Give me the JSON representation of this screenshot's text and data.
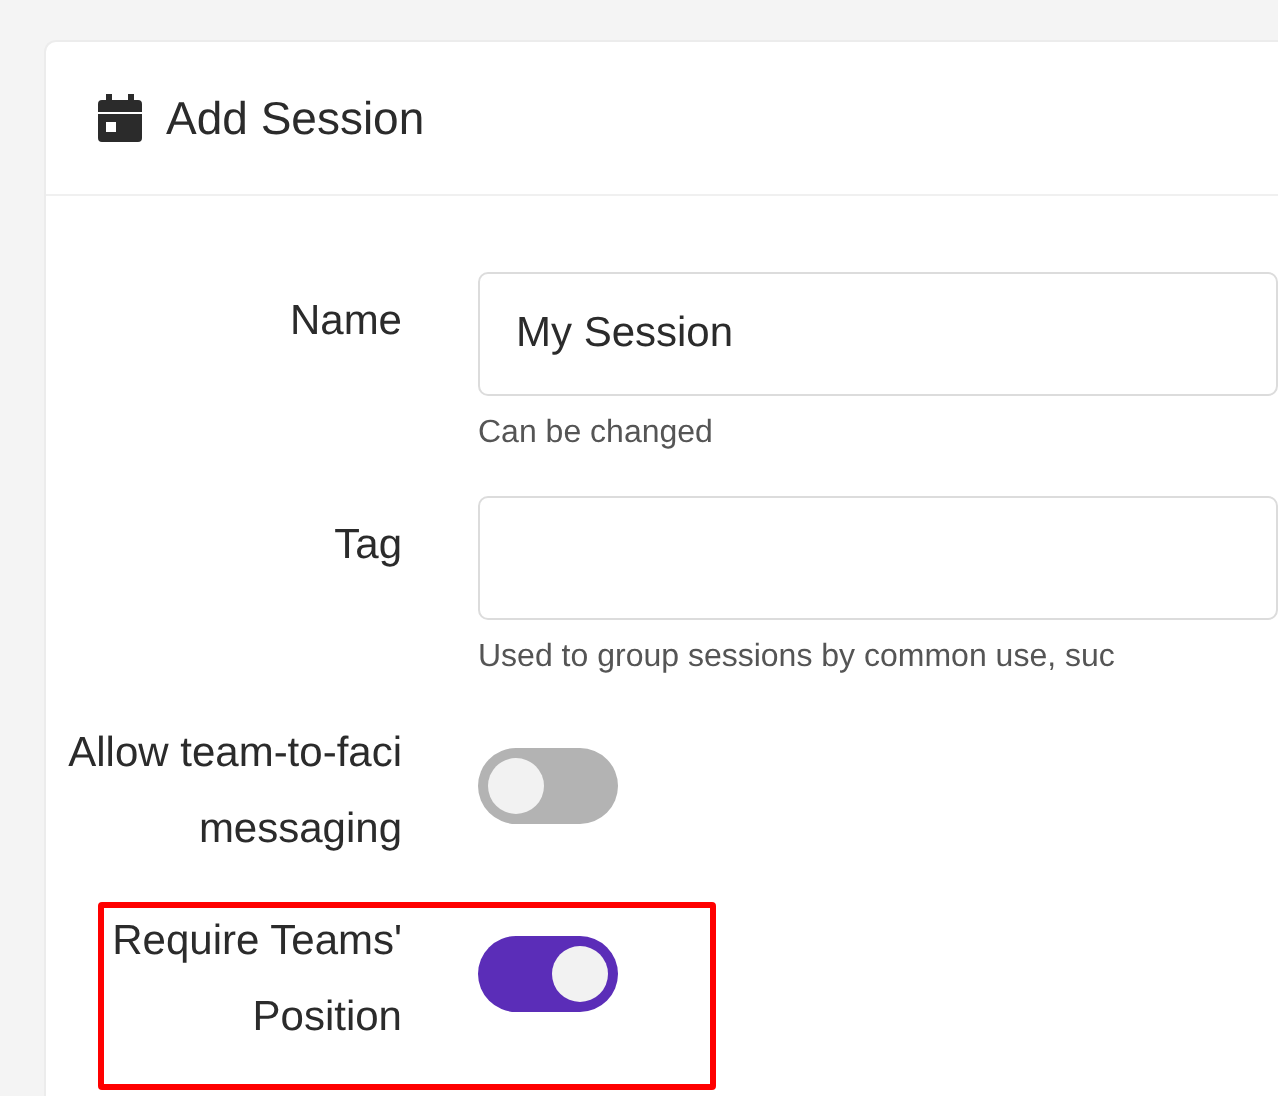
{
  "card": {
    "title": "Add Session"
  },
  "fields": [
    {
      "kind": "text",
      "label": "Name",
      "value": "My Session",
      "help": "Can be changed",
      "highlighted": false
    },
    {
      "kind": "text",
      "label": "Tag",
      "help": "Used to group sessions by common use, suc",
      "highlighted": false
    },
    {
      "kind": "toggle",
      "label": "Allow team-to-faci messaging",
      "on": false,
      "highlighted": false
    },
    {
      "kind": "toggle",
      "label": "Require Teams' Position",
      "on": true,
      "highlighted": true
    }
  ]
}
